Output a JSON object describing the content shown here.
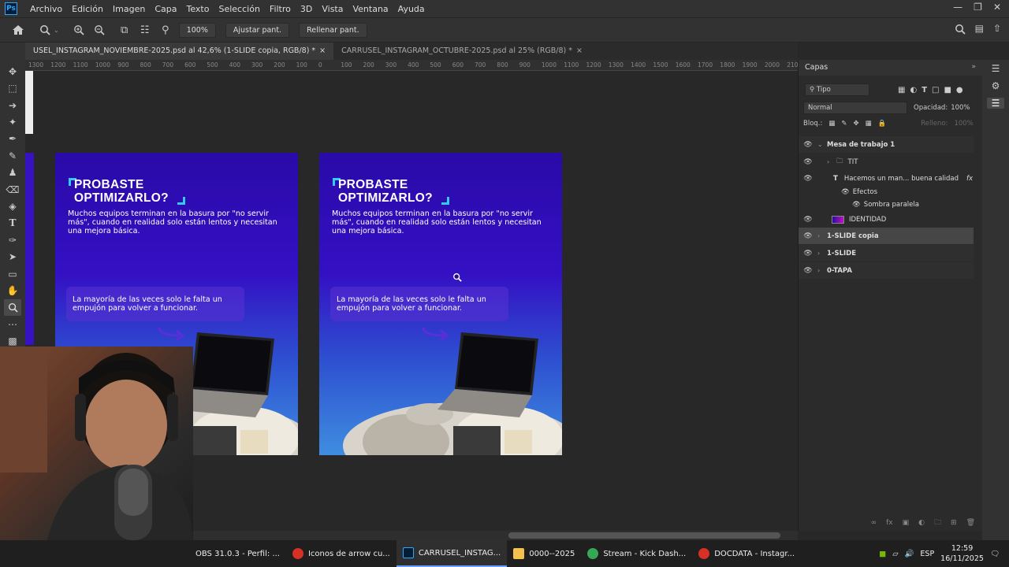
{
  "menubar": {
    "logo": "Ps",
    "items": [
      "Archivo",
      "Edición",
      "Imagen",
      "Capa",
      "Texto",
      "Selección",
      "Filtro",
      "3D",
      "Vista",
      "Ventana",
      "Ayuda"
    ]
  },
  "options": {
    "zoom_value": "100%",
    "fit_screen": "Ajustar pant.",
    "fill_screen": "Rellenar pant."
  },
  "tabs": [
    {
      "label": "USEL_INSTAGRAM_NOVIEMBRE-2025.psd al 42,6% (1-SLIDE copia, RGB/8) *",
      "close": "×"
    },
    {
      "label": "CARRUSEL_INSTAGRAM_OCTUBRE-2025.psd al 25% (RGB/8) *",
      "close": "×"
    }
  ],
  "ruler_labels": [
    "1300",
    "1200",
    "1100",
    "1000",
    "900",
    "800",
    "700",
    "600",
    "500",
    "400",
    "300",
    "200",
    "100",
    "0",
    "100",
    "200",
    "300",
    "400",
    "500",
    "600",
    "700",
    "800",
    "900",
    "1000",
    "1100",
    "1200",
    "1300",
    "1400",
    "1500",
    "1600",
    "1700",
    "1800",
    "1900",
    "2000",
    "210"
  ],
  "slide": {
    "title_line1": "PROBASTE",
    "title_line2": "OPTIMIZARLO?",
    "body": "Muchos equipos terminan en la basura por \"no servir más\", cuando en realidad solo están lentos y necesitan una mejora básica.",
    "box_text": "La mayoría de las veces solo le falta un empujón para volver a funcionar."
  },
  "layers_panel": {
    "title": "Capas",
    "filter": "Tipo",
    "blend_mode": "Normal",
    "opacity_label": "Opacidad:",
    "opacity_value": "100%",
    "lock_label": "Bloq.:",
    "fill_label": "Relleno:",
    "fill_value": "100%",
    "layers": [
      {
        "name": "Mesa de trabajo 1",
        "kind": "artboard"
      },
      {
        "name": "TIT",
        "kind": "group"
      },
      {
        "name": "Hacemos un man... buena calidad",
        "kind": "text",
        "fx": "fx"
      },
      {
        "name": "Efectos",
        "kind": "effects"
      },
      {
        "name": "Sombra paralela",
        "kind": "effect"
      },
      {
        "name": "IDENTIDAD",
        "kind": "smart"
      },
      {
        "name": "1-SLIDE copia",
        "kind": "artboard",
        "selected": true
      },
      {
        "name": "1-SLIDE",
        "kind": "artboard"
      },
      {
        "name": "0-TAPA",
        "kind": "artboard"
      }
    ]
  },
  "taskbar": {
    "items": [
      {
        "label": "OBS 31.0.3 - Perfil: ...",
        "icon_color": "#444444"
      },
      {
        "label": "Iconos de arrow cu...",
        "icon_color": "#d93025"
      },
      {
        "label": "CARRUSEL_INSTAG...",
        "icon_color": "#31a8ff",
        "active": true
      },
      {
        "label": "0000--2025",
        "icon_color": "#f2c14e"
      },
      {
        "label": "Stream - Kick Dash...",
        "icon_color": "#34a853"
      },
      {
        "label": "DOCDATA - Instagr...",
        "icon_color": "#d93025"
      }
    ],
    "lang": "ESP",
    "time": "12:59",
    "date": "16/11/2025"
  },
  "colors": {
    "accent": "#35c9f5",
    "slide_top": "#2a0aa8",
    "slide_bottom": "#3f8de0",
    "ps_blue": "#31a8ff"
  }
}
